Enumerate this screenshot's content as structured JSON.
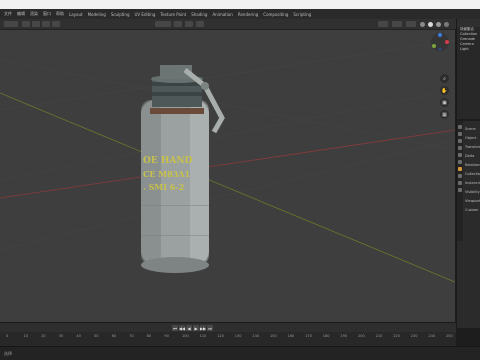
{
  "menu": {
    "items": [
      "文件",
      "编辑",
      "渲染",
      "窗口",
      "帮助",
      "Layout",
      "Modeling",
      "Sculpting",
      "UV Editing",
      "Texture Paint",
      "Shading",
      "Animation",
      "Rendering",
      "Compositing",
      "Scripting"
    ]
  },
  "outliner": {
    "rows": [
      "场景集合",
      "Collection",
      "Grenade",
      "Camera",
      "Light"
    ]
  },
  "properties": {
    "labels": [
      "Scene",
      "Object",
      "Transform",
      "Delta",
      "Relations",
      "Collections",
      "Instancing",
      "Visibility",
      "Viewport",
      "Custom"
    ]
  },
  "timeline": {
    "ticks": [
      "0",
      "10",
      "20",
      "30",
      "40",
      "50",
      "60",
      "70",
      "80",
      "90",
      "100",
      "110",
      "120",
      "130",
      "140",
      "150",
      "160",
      "170",
      "180",
      "190",
      "200",
      "210",
      "220",
      "230",
      "240",
      "250"
    ],
    "play_icons": [
      "⏮",
      "◀◀",
      "◀",
      "▶",
      "▶▶",
      "⏭"
    ]
  },
  "status": {
    "text": "选择"
  },
  "colors": {
    "accent": "#d49a3a",
    "x_axis": "#8a3a3a",
    "y_axis": "#6a7a2a",
    "viewport": "#3e3e3e"
  },
  "viewport_icons": [
    "zoom-icon",
    "hand-icon",
    "camera-icon",
    "grid-icon"
  ]
}
